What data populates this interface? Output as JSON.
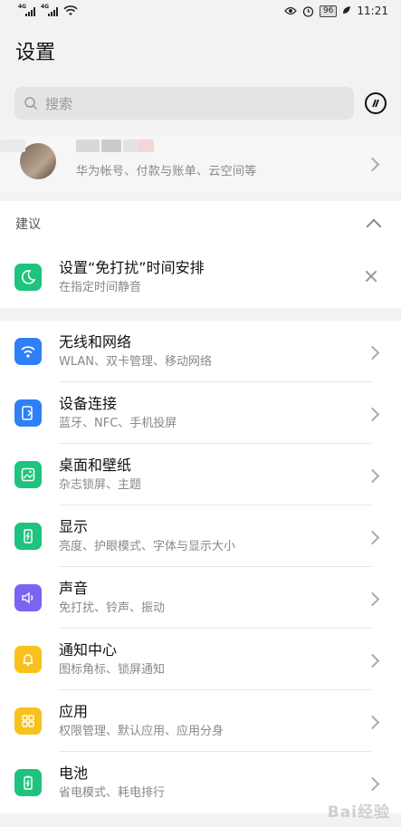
{
  "status_bar": {
    "signal1": "4G",
    "signal2": "4G",
    "battery": "96",
    "time": "11:21"
  },
  "header": {
    "title": "设置"
  },
  "search": {
    "placeholder": "搜索"
  },
  "account": {
    "subtitle": "华为帐号、付款与账单、云空间等"
  },
  "suggestion": {
    "section_label": "建议",
    "item_title": "设置“免打扰”时间安排",
    "item_subtitle": "在指定时间静音",
    "icon": "moon-icon",
    "icon_color": "#1ec37d"
  },
  "settings": [
    {
      "title": "无线和网络",
      "subtitle": "WLAN、双卡管理、移动网络",
      "icon": "wifi-icon",
      "color": "#2f80f7"
    },
    {
      "title": "设备连接",
      "subtitle": "蓝牙、NFC、手机投屏",
      "icon": "device-connect-icon",
      "color": "#2f80f7"
    },
    {
      "title": "桌面和壁纸",
      "subtitle": "杂志锁屏、主题",
      "icon": "wallpaper-icon",
      "color": "#1ec37d"
    },
    {
      "title": "显示",
      "subtitle": "亮度、护眼模式、字体与显示大小",
      "icon": "display-icon",
      "color": "#1ec37d"
    },
    {
      "title": "声音",
      "subtitle": "免打扰、铃声、振动",
      "icon": "sound-icon",
      "color": "#7a64f2"
    },
    {
      "title": "通知中心",
      "subtitle": "图标角标、锁屏通知",
      "icon": "bell-icon",
      "color": "#f7c21b"
    },
    {
      "title": "应用",
      "subtitle": "权限管理、默认应用、应用分身",
      "icon": "apps-icon",
      "color": "#f7c21b"
    },
    {
      "title": "电池",
      "subtitle": "省电模式、耗电排行",
      "icon": "battery-icon",
      "color": "#1ec37d"
    }
  ],
  "watermark": "Bai经验"
}
